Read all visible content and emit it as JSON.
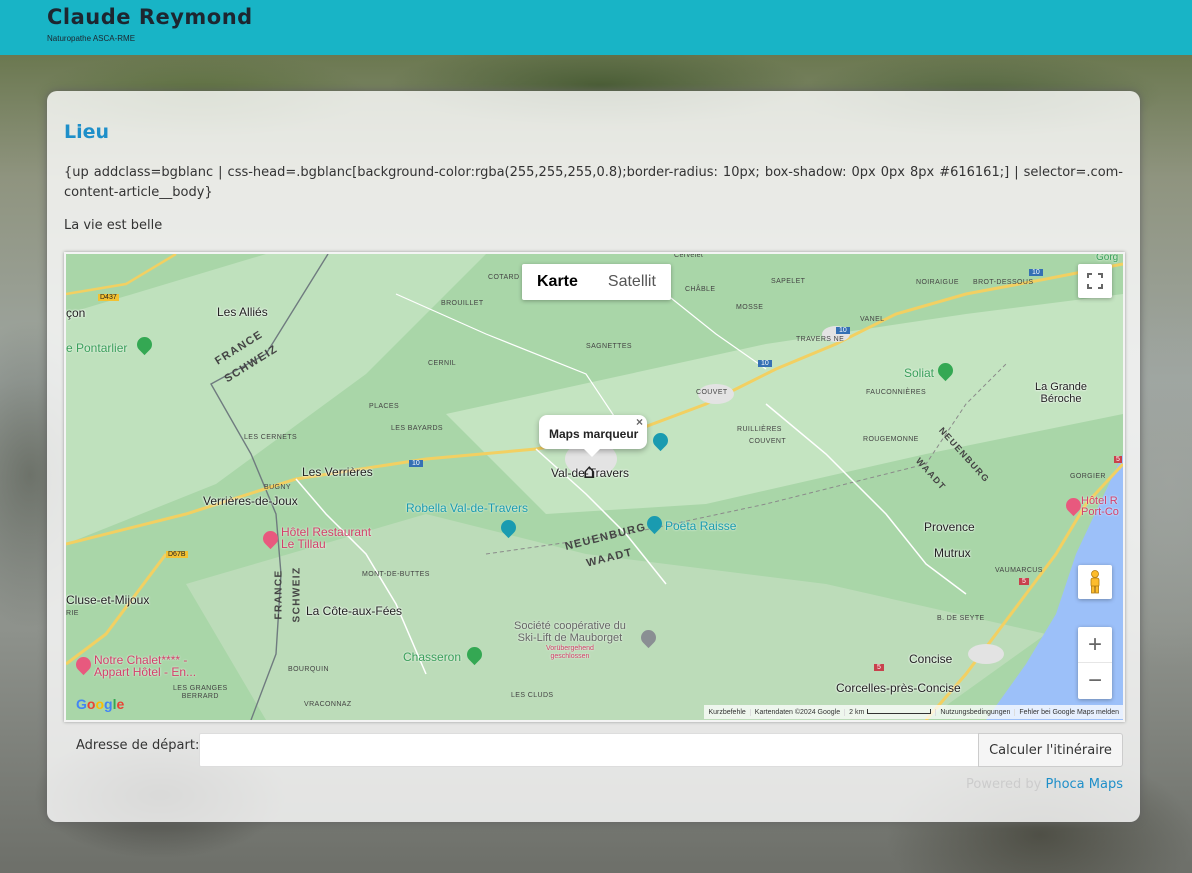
{
  "site": {
    "title": "Claude Reymond",
    "subtitle": "Naturopathe ASCA-RME"
  },
  "article": {
    "title": "Lieu",
    "code_text": "{up addclass=bgblanc | css-head=.bgblanc[background-color:rgba(255,255,255,0.8);border-radius: 10px; box-shadow: 0px 0px 8px #616161;] | selector=.com-content-article__body}",
    "text": "La vie est belle"
  },
  "map": {
    "type_buttons": [
      "Karte",
      "Satellit"
    ],
    "active_type": "Karte",
    "infowindow": {
      "text": "Maps marqueur",
      "close": "×"
    },
    "labels": {
      "les_allies": "Les Alliés",
      "pontarlier": "e Pontarlier",
      "france1": "FRANCE",
      "schweiz1": "SCHWEIZ",
      "cernil": "CERNIL",
      "sagnettes": "SAGNETTES",
      "brouillet": "BROUILLET",
      "cotard": "COTARD",
      "chable": "CHÂBLE",
      "sapelet": "SAPELET",
      "cervelet": "Cervelet",
      "mosse": "MOSSE",
      "vanel": "VANEL",
      "travers_ne": "TRAVERS NE",
      "noiraigue": "NOIRAIGUE",
      "brot_dessous": "BROT-DESSOUS",
      "gorg": "Gorg",
      "soliat": "Soliat",
      "la_grande_beroche": "La Grande\nBéroche",
      "fauconnieres": "FAUCONNIÈRES",
      "couvet_small": "COUVET",
      "places": "PLACES",
      "les_bayards": "LES BAYARDS",
      "les_cernets": "LES CERNETS",
      "ruillieres": "RUILLIÈRES",
      "couvent": "COUVENT",
      "rougemonne": "ROUGEMONNE",
      "neuenburg_diag": "NEUENBURG",
      "waadt_diag": "WAADT",
      "les_verrieres": "Les Verrières",
      "val_de_travers": "Val-de-Travers",
      "bugny": "BUGNY",
      "verrieres_de_joux": "Verrières-de-Joux",
      "robella": "Robella Val-de-Travers",
      "gorgier": "GORGIER",
      "hotel_r": "Hôtel R\nPort-Co",
      "hotel_restaurant": "Hôtel Restaurant\nLe Tillau",
      "neuenburg": "NEUENBURG",
      "waadt": "WAADT",
      "poeta_raisse": "Poëta Raisse",
      "provence": "Provence",
      "mutrux": "Mutrux",
      "mont_de_buttes": "MONT-DE-BUTTES",
      "vaumarcus": "VAUMARCUS",
      "cluse_et_mijoux": "Cluse-et-Mijoux",
      "rie": "RIE",
      "france2": "FRANCE",
      "schweiz2": "SCHWEIZ",
      "la_cote_aux_fees": "La Côte-aux-Fées",
      "societe": "Société coopérative du\nSki-Lift de Mauborget",
      "voruebergehend": "Vorübergehend\ngeschlossen",
      "b_de_seyte": "B. DE SEYTE",
      "chasseron": "Chasseron",
      "bourquin": "BOURQUIN",
      "notre_chalet": "Notre Chalet**** -\nAppart Hôtel - En...",
      "concise": "Concise",
      "les_granges": "LES GRANGES\nBERRARD",
      "vraconnaz": "VRACONNAZ",
      "les_cluds": "LES CLUDS",
      "corcelles": "Corcelles-près-Concise",
      "con": "çon"
    },
    "road_numbers": [
      "D437",
      "10",
      "10",
      "10",
      "10",
      "D67B",
      "5",
      "5",
      "5"
    ],
    "google_logo": [
      "G",
      "o",
      "o",
      "g",
      "l",
      "e"
    ],
    "attribution": [
      "Kurzbefehle",
      "Kartendaten ©2024 Google",
      "2 km",
      "Nutzungsbedingungen",
      "Fehler bei Google Maps melden"
    ],
    "zoom_in": "+",
    "zoom_out": "−",
    "fullscreen_icon": "fullscreen-icon",
    "pegman_icon": "pegman-icon"
  },
  "route": {
    "label": "Adresse de départ:",
    "input_value": "",
    "button": "Calculer l'itinéraire"
  },
  "powered": {
    "prefix": "Powered by",
    "link": "Phoca Maps"
  },
  "colors": {
    "header": "#18b4c6",
    "accent": "#1e8fc9",
    "map_land": "#a9d6a8",
    "map_water": "#9cc0f9"
  }
}
